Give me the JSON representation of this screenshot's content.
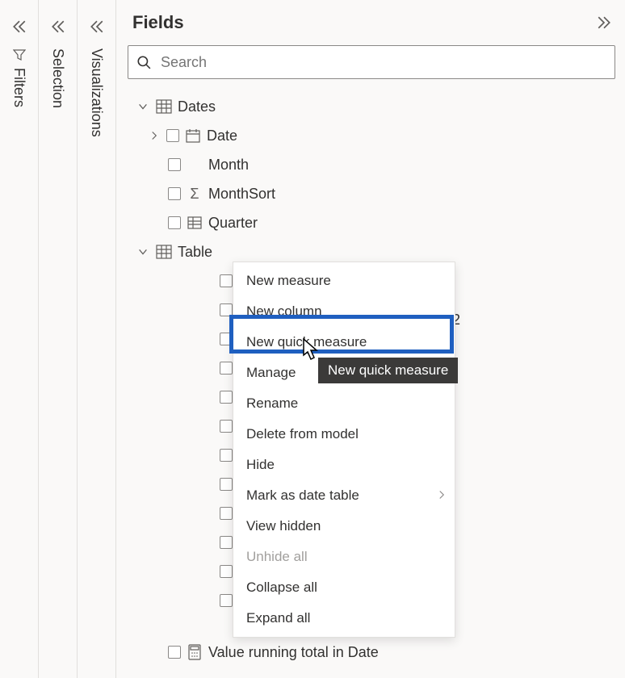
{
  "rails": {
    "filters": "Filters",
    "selection": "Selection",
    "visualizations": "Visualizations"
  },
  "fields": {
    "title": "Fields",
    "search_placeholder": "Search"
  },
  "tree": {
    "t1": {
      "name": "Dates"
    },
    "t1_fields": {
      "date": "Date",
      "month": "Month",
      "monthsort": "MonthSort",
      "quarter": "Quarter"
    },
    "t2": {
      "name": "Table"
    },
    "t2_value": "Value running total in Date"
  },
  "menu": {
    "new_measure": "New measure",
    "new_column": "New column",
    "new_quick_measure": "New quick measure",
    "manage": "Manage",
    "rename": "Rename",
    "delete": "Delete from model",
    "hide": "Hide",
    "mark_date": "Mark as date table",
    "view_hidden": "View hidden",
    "unhide_all": "Unhide all",
    "collapse_all": "Collapse all",
    "expand_all": "Expand all"
  },
  "tooltip": "New quick measure",
  "overflow_digit": "2"
}
